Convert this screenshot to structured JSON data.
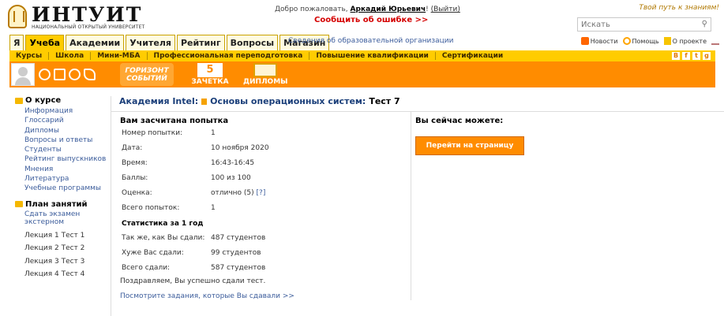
{
  "header": {
    "logo_word": "ИНТУИТ",
    "logo_sub": "НАЦИОНАЛЬНЫЙ ОТКРЫТЫЙ УНИВЕРСИТЕТ",
    "welcome_prefix": "Добро пожаловать,",
    "user_name": "Аркадий Юрьевич",
    "exit_label": "(Выйти)",
    "report_error": "Сообщить об ошибке >>",
    "slogan": "Твой путь к знаниям!",
    "search_placeholder": "Искать"
  },
  "tabs": [
    {
      "label": "Я",
      "active": false
    },
    {
      "label": "Учеба",
      "active": true
    },
    {
      "label": "Академии",
      "active": false
    },
    {
      "label": "Учителя",
      "active": false
    },
    {
      "label": "Рейтинг",
      "active": false
    },
    {
      "label": "Вопросы",
      "active": false
    },
    {
      "label": "Магазин",
      "active": false
    }
  ],
  "org_link": "Сведения об образовательной организации",
  "right_links": {
    "news": "Новости",
    "help": "Помощь",
    "about": "О проекте"
  },
  "submenu": [
    "Курсы",
    "Школа",
    "Мини-МБА",
    "Профессиональная переподготовка",
    "Повышение квалификации",
    "Сертификации"
  ],
  "socials": [
    "B",
    "f",
    "t",
    "g"
  ],
  "orange_bar": {
    "horizon_line1": "ГОРИЗОНТ",
    "horizon_line2": "СОБЫТИЙ",
    "zachetka_num": "5",
    "zachetka_label": "ЗАЧЕТКА",
    "diplomy_label": "ДИПЛОМЫ"
  },
  "sidebar": {
    "about_title": "О курсе",
    "about_links": [
      "Информация",
      "Глоссарий",
      "Дипломы",
      "Вопросы и ответы",
      "Студенты",
      "Рейтинг выпускников",
      "Мнения",
      "Литература",
      "Учебные программы"
    ],
    "plan_title": "План занятий",
    "plan_items": [
      "Сдать экзамен экстерном",
      "Лекция 1 Тест 1",
      "Лекция 2 Тест 2",
      "Лекция 3 Тест 3",
      "Лекция 4 Тест 4"
    ]
  },
  "breadcrumb": {
    "academy": "Академия Intel:",
    "course": "Основы операционных систем:",
    "test": "Тест 7"
  },
  "result": {
    "title": "Вам засчитана попытка",
    "rows": [
      {
        "label": "Номер попытки:",
        "value": "1"
      },
      {
        "label": "Дата:",
        "value": "10 ноября 2020"
      },
      {
        "label": "Время:",
        "value": "16:43-16:45"
      },
      {
        "label": "Баллы:",
        "value": "100 из 100"
      },
      {
        "label": "Оценка:",
        "value": "отлично (5)",
        "hint": "[?]"
      },
      {
        "label": "Всего попыток:",
        "value": "1"
      }
    ],
    "stats_title": "Статистика за 1 год",
    "stats": [
      {
        "label": "Так же, как Вы сдали:",
        "value": "487 студентов"
      },
      {
        "label": "Хуже Вас сдали:",
        "value": "99 студентов"
      },
      {
        "label": "Всего сдали:",
        "value": "587 студентов"
      }
    ],
    "congrats": "Поздравляем, Вы успешно сдали тест.",
    "see_tasks": "Посмотрите задания, которые Вы сдавали >>"
  },
  "can_do": {
    "title": "Вы сейчас можете:",
    "button": "Перейти на страницу курса"
  },
  "colors": {
    "accent_orange": "#ff8c00",
    "accent_yellow": "#ffcc00",
    "link_blue": "#3b5c9b",
    "error_red": "#d40000"
  }
}
